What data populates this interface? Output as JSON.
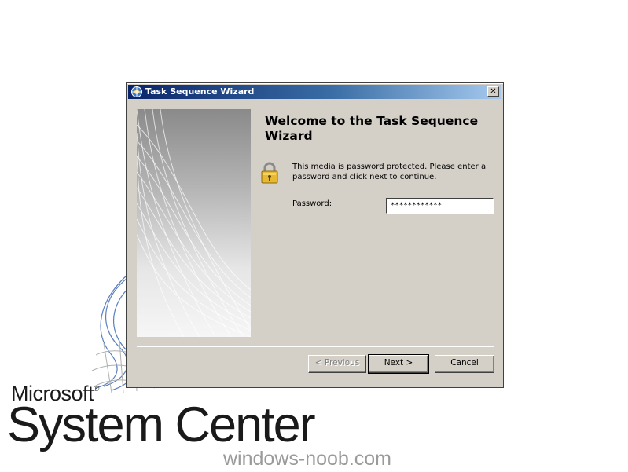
{
  "window": {
    "title": "Task Sequence Wizard",
    "close_glyph": "✕"
  },
  "content": {
    "heading": "Welcome to the Task Sequence Wizard",
    "message": "This media is password protected.  Please enter a password and click next to continue.",
    "password_label": "Password:",
    "password_value": "************"
  },
  "buttons": {
    "previous": "< Previous",
    "next": "Next >",
    "cancel": "Cancel"
  },
  "background": {
    "brand_microsoft": "Microsoft",
    "brand_registered": "®",
    "brand_product": "System Center",
    "website": "windows-noob.com"
  },
  "icons": {
    "title_icon": "wizard-icon",
    "lock_icon": "padlock-icon",
    "close_icon": "close-icon"
  },
  "colors": {
    "dialog_face": "#d4d0c8",
    "titlebar_start": "#0a246a",
    "titlebar_end": "#a6caf0",
    "lock_gold": "#e8b830"
  }
}
